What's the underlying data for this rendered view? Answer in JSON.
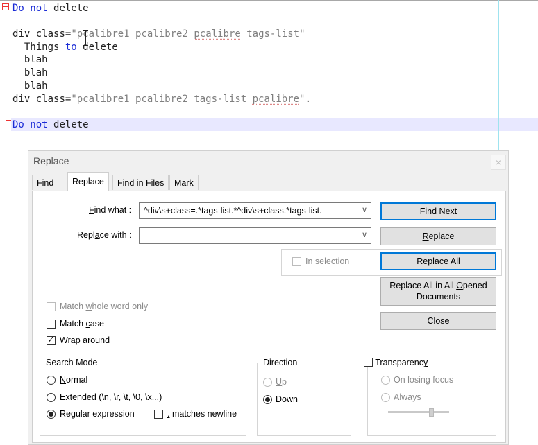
{
  "editor": {
    "line1_kw1": "Do",
    "line1_kw2": "not",
    "line1_rest": "delete",
    "line3_tag": "div",
    "line3_attr": "class=",
    "line3_q1": "\"",
    "line3_w1": "pcalibre1",
    "line3_w2": "pcalibre2",
    "line3_w3": "pcalibre",
    "line3_w4": "tags-list\"",
    "line4_a": "Things",
    "line4_kw": "to",
    "line4_b": "delete",
    "line5": "blah",
    "line6": "blah",
    "line7": "blah",
    "line8_tag": "div",
    "line8_attr": "class=",
    "line8_str1": "\"pcalibre1 pcalibre2 tags-list ",
    "line8_str2": "pcalibre",
    "line8_str3": "\"",
    "line8_end": ".",
    "line10_kw1": "Do",
    "line10_kw2": "not",
    "line10_rest": "delete"
  },
  "dialog": {
    "title": "Replace",
    "close_glyph": "×",
    "tabs": [
      {
        "label": "Find"
      },
      {
        "label": "Replace"
      },
      {
        "label": "Find in Files"
      },
      {
        "label": "Mark"
      }
    ],
    "find_label_mn": "F",
    "find_label_rest": "ind what :",
    "find_value": "^div\\s+class=.*tags-list.*^div\\s+class.*tags-list.",
    "replace_label_a": "Repl",
    "replace_label_mn": "a",
    "replace_label_b": "ce with :",
    "replace_value": "",
    "in_selection_a": "In selec",
    "in_selection_mn": "t",
    "in_selection_b": "ion",
    "find_next": "Find Next",
    "replace_btn_mn": "R",
    "replace_btn_rest": "eplace",
    "replace_all_a": "Replace ",
    "replace_all_mn": "A",
    "replace_all_b": "ll",
    "replace_all_docs_a": "Replace All in All ",
    "replace_all_docs_mn": "O",
    "replace_all_docs_b": "pened",
    "replace_all_docs_line2": "Documents",
    "close": "Close",
    "match_whole_a": "Match ",
    "match_whole_mn": "w",
    "match_whole_b": "hole word only",
    "match_case_a": "Match ",
    "match_case_mn": "c",
    "match_case_b": "ase",
    "wrap_a": "Wra",
    "wrap_mn": "p",
    "wrap_b": " around",
    "check_mark": "✓",
    "search_mode_title": "Search Mode",
    "mode_normal_mn": "N",
    "mode_normal_rest": "ormal",
    "mode_ext_a": "E",
    "mode_ext_mn": "x",
    "mode_ext_b": "tended (\\n, \\r, \\t, \\0, \\x...)",
    "mode_regex_a": "Re",
    "mode_regex_mn": "g",
    "mode_regex_b": "ular expression",
    "matches_newline_mn": ".",
    "matches_newline_rest": " matches newline",
    "direction_title": "Direction",
    "dir_up_mn": "U",
    "dir_up_rest": "p",
    "dir_down_mn": "D",
    "dir_down_rest": "own",
    "transparency_a": "Transparenc",
    "transparency_mn": "y",
    "on_losing_focus": "On losing focus",
    "always": "Always"
  },
  "state": {
    "match_whole_word": false,
    "match_case": false,
    "wrap_around": true,
    "search_mode": "Regular expression",
    "matches_newline": false,
    "direction": "Down",
    "transparency": false,
    "in_selection": false
  },
  "colors": {
    "keyword": "#1a2bd6",
    "string": "#7f7f7f",
    "fold_marker": "#e33",
    "edge_line": "#9fe3ef",
    "current_line": "#e8e8ff",
    "focus_border": "#0078d7"
  }
}
